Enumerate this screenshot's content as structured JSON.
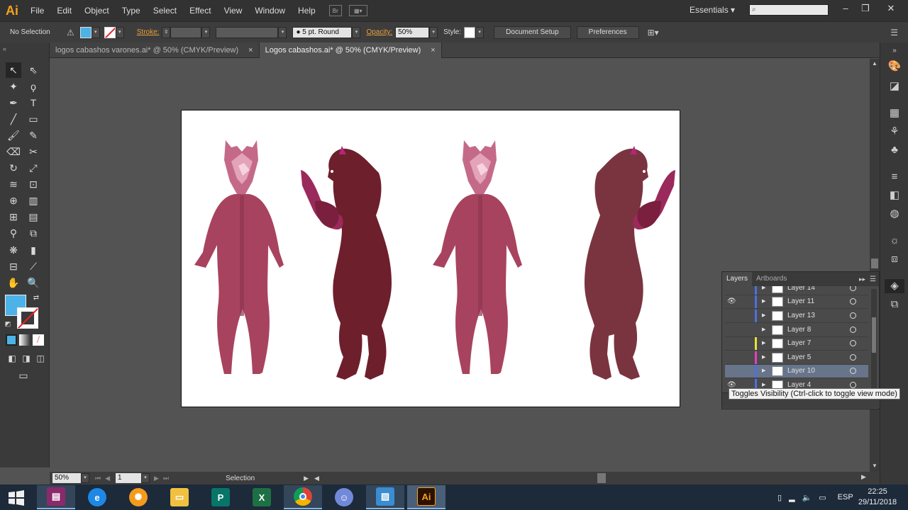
{
  "app": {
    "logo": "Ai",
    "workspace": "Essentials"
  },
  "menu": [
    "File",
    "Edit",
    "Object",
    "Type",
    "Select",
    "Effect",
    "View",
    "Window",
    "Help"
  ],
  "menu_icons": {
    "bridge": "Br"
  },
  "control_bar": {
    "selection_label": "No Selection",
    "stroke_label": "Stroke:",
    "brush_label": "5 pt. Round",
    "opacity_label": "Opacity:",
    "opacity_value": "50%",
    "style_label": "Style:",
    "document_setup": "Document Setup",
    "preferences": "Preferences"
  },
  "tabs": [
    {
      "label": "logos cabashos varones.ai* @ 50% (CMYK/Preview)",
      "close": "×"
    },
    {
      "label": "Logos cabashos.ai* @ 50% (CMYK/Preview)",
      "close": "×"
    }
  ],
  "colors": {
    "fill": "#4cb3e8",
    "figure_pink": "#a8435f",
    "figure_dark": "#6e1f2c",
    "figure_mauve": "#7a3440",
    "accent_magenta": "#9b2a5c"
  },
  "layers_panel": {
    "tabs": [
      "Layers",
      "Artboards"
    ],
    "rows": [
      {
        "name": "Layer 14",
        "color": "#4f6fe0",
        "eye": false,
        "selected": false
      },
      {
        "name": "Layer 11",
        "color": "#4f6fe0",
        "eye": true,
        "selected": false
      },
      {
        "name": "Layer 13",
        "color": "#4f6fe0",
        "eye": false,
        "selected": false
      },
      {
        "name": "Layer 8",
        "color": "",
        "eye": false,
        "selected": false
      },
      {
        "name": "Layer 7",
        "color": "#e3e33c",
        "eye": false,
        "selected": false
      },
      {
        "name": "Layer 5",
        "color": "#e040c0",
        "eye": false,
        "selected": false
      },
      {
        "name": "Layer 10",
        "color": "#4f6fe0",
        "eye": false,
        "selected": true
      },
      {
        "name": "Layer 4",
        "color": "#4f6fe0",
        "eye": true,
        "selected": false
      }
    ],
    "tooltip": "Toggles Visibility (Ctrl-click to toggle view mode)"
  },
  "status": {
    "zoom": "50%",
    "artboard": "1",
    "tool": "Selection"
  },
  "taskbar": {
    "apps": [
      {
        "name": "winrar-icon",
        "label": "",
        "color": "#8b2a6b"
      },
      {
        "name": "internet-explorer-icon",
        "label": "e",
        "color": "#1e88e5"
      },
      {
        "name": "settings-app-icon",
        "label": "",
        "color": "#f59a1b"
      },
      {
        "name": "file-explorer-icon",
        "label": "",
        "color": "#f0c040"
      },
      {
        "name": "publisher-icon",
        "label": "P",
        "color": "#077568"
      },
      {
        "name": "excel-icon",
        "label": "X",
        "color": "#1d7044"
      },
      {
        "name": "chrome-icon",
        "label": "",
        "color": "#db4437"
      },
      {
        "name": "discord-icon",
        "label": "",
        "color": "#7289da"
      },
      {
        "name": "photos-icon",
        "label": "",
        "color": "#3b8cd0"
      },
      {
        "name": "illustrator-icon",
        "label": "Ai",
        "color": "#2b1100"
      }
    ],
    "language": "ESP",
    "time": "22:25",
    "date": "29/11/2018"
  }
}
